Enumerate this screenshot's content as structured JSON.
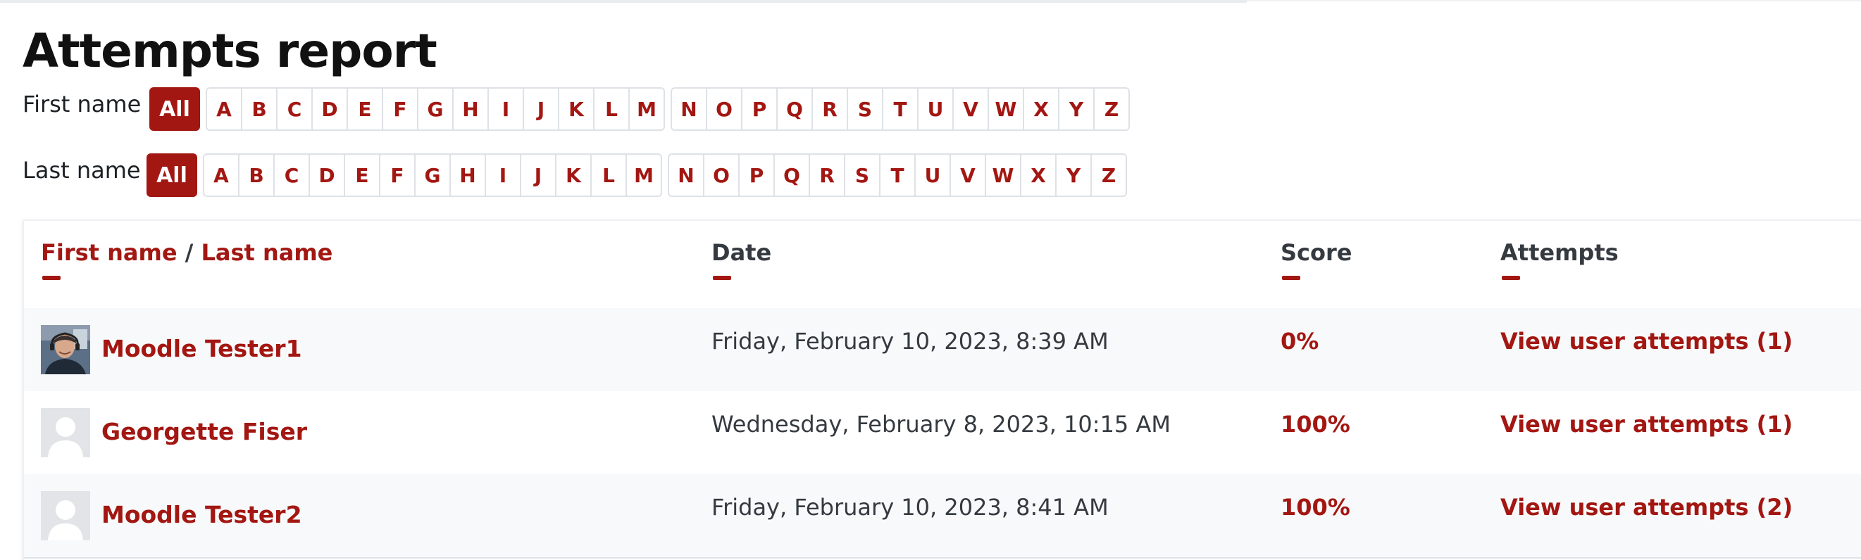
{
  "page": {
    "title": "Attempts report"
  },
  "filters": {
    "first_name": {
      "label": "First name",
      "all_label": "All",
      "letters_group1": [
        "A",
        "B",
        "C",
        "D",
        "E",
        "F",
        "G",
        "H",
        "I",
        "J",
        "K",
        "L",
        "M"
      ],
      "letters_group2": [
        "N",
        "O",
        "P",
        "Q",
        "R",
        "S",
        "T",
        "U",
        "V",
        "W",
        "X",
        "Y",
        "Z"
      ],
      "selected": "All"
    },
    "last_name": {
      "label": "Last name",
      "all_label": "All",
      "letters_group1": [
        "A",
        "B",
        "C",
        "D",
        "E",
        "F",
        "G",
        "H",
        "I",
        "J",
        "K",
        "L",
        "M"
      ],
      "letters_group2": [
        "N",
        "O",
        "P",
        "Q",
        "R",
        "S",
        "T",
        "U",
        "V",
        "W",
        "X",
        "Y",
        "Z"
      ],
      "selected": "All"
    }
  },
  "table": {
    "headers": {
      "first_name": "First name",
      "separator": "/",
      "last_name": "Last name",
      "date": "Date",
      "score": "Score",
      "attempts": "Attempts"
    },
    "rows": [
      {
        "name": "Moodle Tester1",
        "avatar": "user-photo",
        "date": "Friday, February 10, 2023, 8:39 AM",
        "score": "0%",
        "attempts": "View user attempts (1)"
      },
      {
        "name": "Georgette Fiser",
        "avatar": "default-user-icon",
        "date": "Wednesday, February 8, 2023, 10:15 AM",
        "score": "100%",
        "attempts": "View user attempts (1)"
      },
      {
        "name": "Moodle Tester2",
        "avatar": "default-user-icon",
        "date": "Friday, February 10, 2023, 8:41 AM",
        "score": "100%",
        "attempts": "View user attempts (2)"
      }
    ]
  },
  "colors": {
    "accent": "#a31712",
    "text": "#1d2125",
    "muted_text": "#343a40",
    "border": "#dee2e6",
    "row_alt": "#f8f9fa"
  }
}
